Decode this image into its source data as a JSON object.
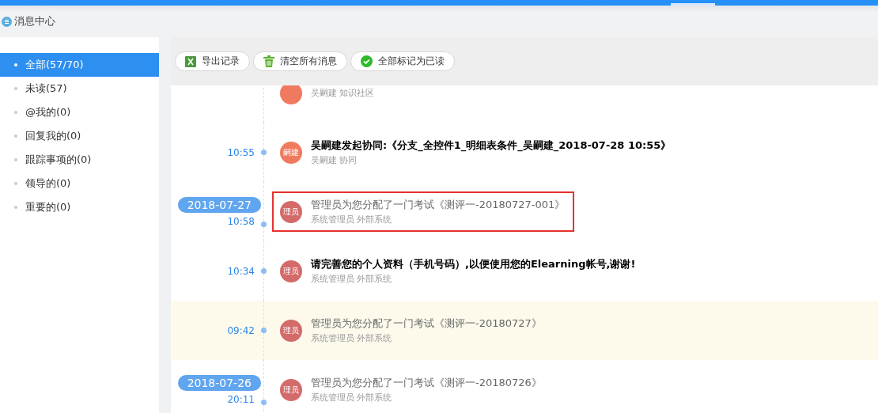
{
  "header": {
    "title": "消息中心"
  },
  "sidebar": {
    "items": [
      {
        "label": "全部(57/70)",
        "selected": true
      },
      {
        "label": "未读(57)",
        "selected": false
      },
      {
        "label": "@我的(0)",
        "selected": false
      },
      {
        "label": "回复我的(0)",
        "selected": false
      },
      {
        "label": "跟踪事项的(0)",
        "selected": false
      },
      {
        "label": "领导的(0)",
        "selected": false
      },
      {
        "label": "重要的(0)",
        "selected": false
      }
    ]
  },
  "toolbar": {
    "buttons": [
      {
        "label": "导出记录",
        "kind": "excel"
      },
      {
        "label": "清空所有消息",
        "kind": "trash"
      },
      {
        "label": "全部标记为已读",
        "kind": "check"
      }
    ]
  },
  "messages": [
    {
      "meta": "吴嗣建 知识社区",
      "color": "#f07a5f",
      "highlighted": false,
      "outlined": false
    },
    {
      "time": "10:55",
      "avatar": "嗣建",
      "color": "#f07a5f",
      "title": "吴嗣建发起协同:《分支_全控件1_明细表条件_吴嗣建_2018-07-28 10:55》",
      "meta": "吴嗣建 协同",
      "unread": true,
      "highlighted": false,
      "outlined": false
    },
    {
      "date": "2018-07-27",
      "time": "10:58",
      "avatar": "理员",
      "color": "#d46b6b",
      "title": "管理员为您分配了一门考试《测评一-20180727-001》",
      "meta": "系统管理员 外部系统",
      "unread": false,
      "highlighted": false,
      "outlined": true
    },
    {
      "time": "10:34",
      "avatar": "理员",
      "color": "#d46b6b",
      "title": "请完善您的个人资料（手机号码）,以便使用您的Elearning帐号,谢谢!",
      "meta": "系统管理员 外部系统",
      "unread": true,
      "highlighted": false,
      "outlined": false
    },
    {
      "time": "09:42",
      "avatar": "理员",
      "color": "#d46b6b",
      "title": "管理员为您分配了一门考试《测评一-20180727》",
      "meta": "系统管理员 外部系统",
      "unread": false,
      "highlighted": true,
      "outlined": false
    },
    {
      "date": "2018-07-26",
      "time": "20:11",
      "avatar": "理员",
      "color": "#d46b6b",
      "title": "管理员为您分配了一门考试《测评一-20180726》",
      "meta": "系统管理员 外部系统",
      "unread": false,
      "highlighted": false,
      "outlined": false
    }
  ]
}
